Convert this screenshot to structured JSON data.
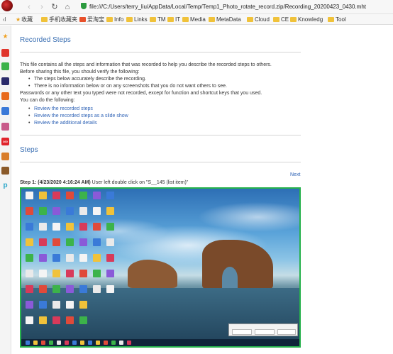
{
  "browser": {
    "address": "file:///C:/Users/terry_liu/AppData/Local/Temp/Temp1_Photo_rotate_record.zip/Recording_20200423_0430.mht",
    "nav_back": "‹",
    "nav_forward": "›",
    "nav_reload": "↻",
    "nav_home": "⌂"
  },
  "bookmarks": {
    "collapse": "‹l",
    "items": [
      {
        "label": "收藏",
        "icon": "star-icon"
      },
      {
        "label": "手机收藏夹",
        "icon": "folder-icon"
      },
      {
        "label": "爱淘宝",
        "icon": "taobao-icon"
      },
      {
        "label": "Info",
        "icon": "folder-icon"
      },
      {
        "label": "Links",
        "icon": "folder-icon"
      },
      {
        "label": "TM",
        "icon": "folder-icon"
      },
      {
        "label": "IT",
        "icon": "folder-icon"
      },
      {
        "label": "Media",
        "icon": "folder-icon"
      },
      {
        "label": "MetaData",
        "icon": "folder-icon"
      },
      {
        "label": "Cloud",
        "icon": "folder-icon"
      },
      {
        "label": "CE",
        "icon": "folder-icon"
      },
      {
        "label": "Knowledg",
        "icon": "folder-icon"
      },
      {
        "label": "Tool",
        "icon": "folder-icon"
      }
    ]
  },
  "sidebar": {
    "icons": [
      {
        "name": "favorites-icon",
        "color": "#f0a020",
        "glyph": "★"
      },
      {
        "name": "weibo-icon",
        "color": "#e0352b",
        "glyph": "微"
      },
      {
        "name": "app-green-icon",
        "color": "#3cb34a",
        "glyph": "■"
      },
      {
        "name": "app-dark-icon",
        "color": "#2a2a6a",
        "glyph": "■"
      },
      {
        "name": "app-orange-icon",
        "color": "#e86a1c",
        "glyph": "■"
      },
      {
        "name": "app-blue-icon",
        "color": "#3a79d8",
        "glyph": "■"
      },
      {
        "name": "game-icon",
        "color": "#c85a8a",
        "glyph": "■"
      },
      {
        "name": "hao-icon",
        "color": "#e0242c",
        "glyph": "360"
      },
      {
        "name": "game2-icon",
        "color": "#d97d2a",
        "glyph": "■"
      },
      {
        "name": "game3-icon",
        "color": "#8a5a2a",
        "glyph": "■"
      },
      {
        "name": "p-icon",
        "color": "#2aa6c8",
        "glyph": "p"
      }
    ]
  },
  "page": {
    "title": "Recorded Steps",
    "intro_1": "This file contains all the steps and information that was recorded to help you describe the recorded steps to others.",
    "intro_2": "Before sharing this file, you should verify the following:",
    "bullets": [
      "The steps below accurately describe the recording.",
      "There is no information below or on any screenshots that you do not want others to see."
    ],
    "passwords_note": "Passwords or any other text you typed were not recorded, except for function and shortcut keys that you used.",
    "can_do": "You can do the following:",
    "links": [
      "Review the recorded steps",
      "Review the recorded steps as a slide show",
      "Review the additional details"
    ],
    "steps_heading": "Steps",
    "next_link": "Next",
    "step1_label": "Step 1: (4/23/2020 4:16:24 AM)",
    "step1_text": " User left double click on \"S__145 (list item)\""
  },
  "colors": {
    "heading_blue": "#3a6fb3",
    "link_blue": "#2f63b6",
    "screenshot_border": "#27b24c"
  }
}
